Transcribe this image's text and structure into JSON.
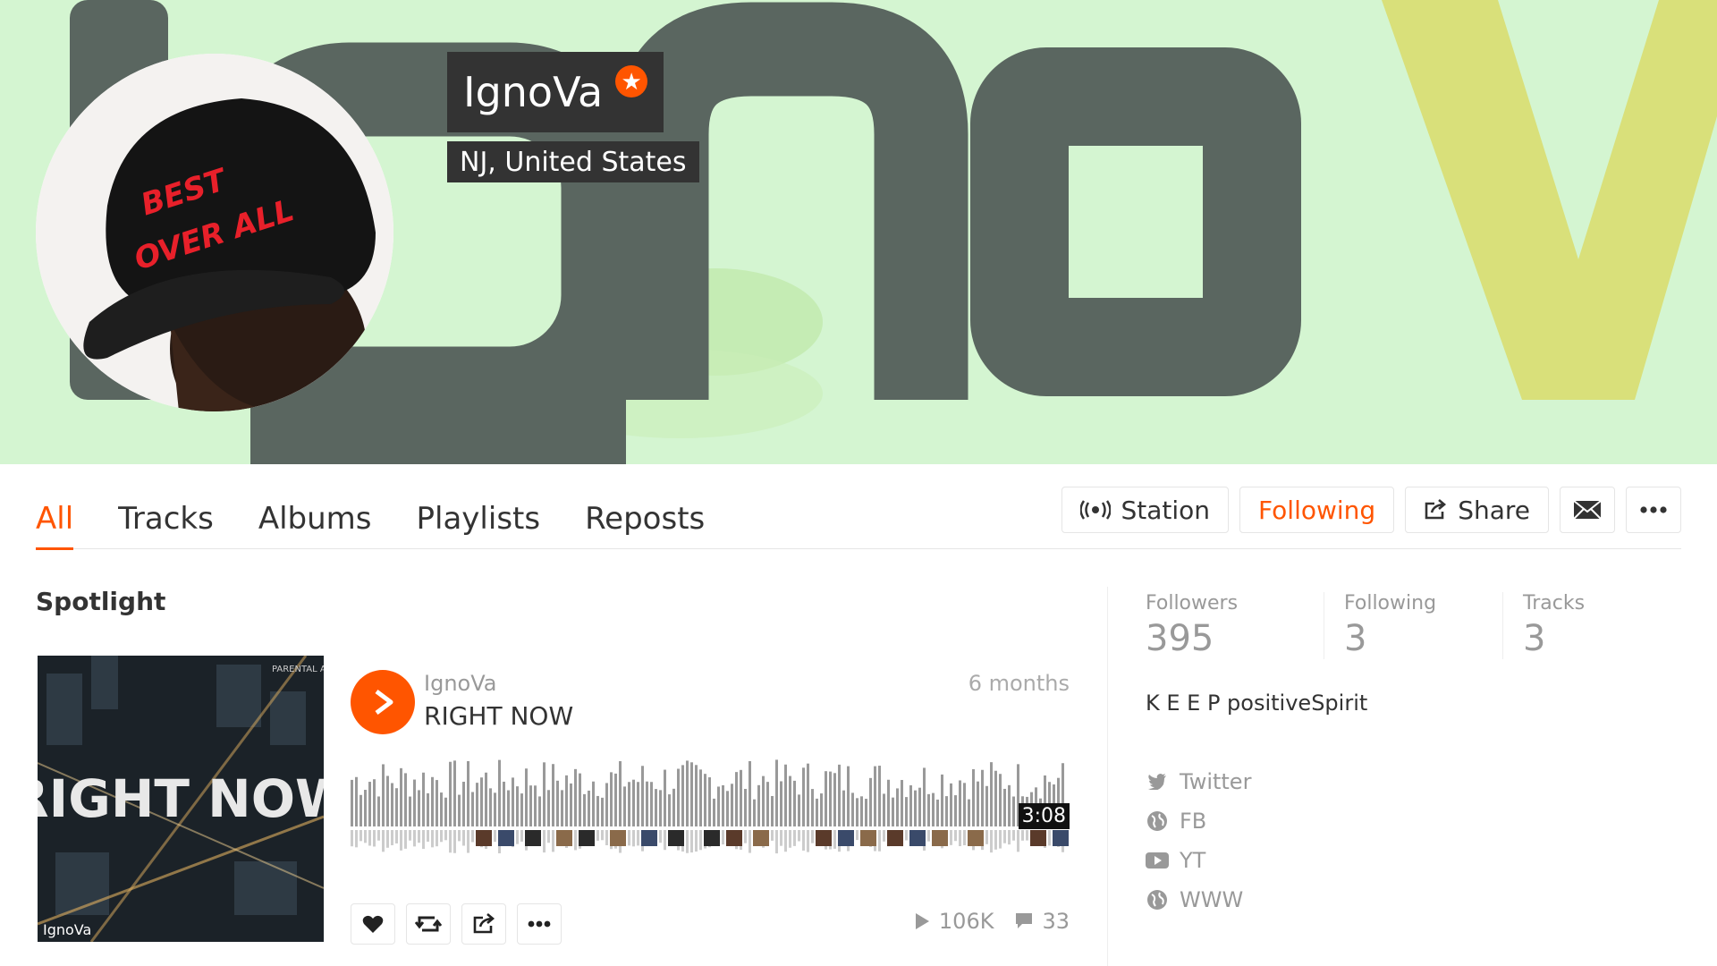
{
  "profile": {
    "name": "IgnoVa",
    "location": "NJ, United States",
    "pro_badge_icon": "star-icon",
    "banner_text": "IgnoVa",
    "avatar_cap_text": "BEST OVER ALL"
  },
  "tabs": [
    {
      "label": "All",
      "active": true
    },
    {
      "label": "Tracks"
    },
    {
      "label": "Albums"
    },
    {
      "label": "Playlists"
    },
    {
      "label": "Reposts"
    }
  ],
  "actions": {
    "station_label": "Station",
    "following_label": "Following",
    "share_label": "Share"
  },
  "spotlight": {
    "title": "Spotlight",
    "track": {
      "user": "IgnoVa",
      "title": "RIGHT NOW",
      "posted": "6 months",
      "duration": "3:08",
      "plays": "106K",
      "comments": "33",
      "cover_text": "RIGHT NOW",
      "cover_brand": "IgnoVa",
      "cover_advisory": "PARENTAL ADVISORY"
    }
  },
  "sidebar": {
    "stats": [
      {
        "label": "Followers",
        "value": "395"
      },
      {
        "label": "Following",
        "value": "3"
      },
      {
        "label": "Tracks",
        "value": "3"
      }
    ],
    "bio": "K E E P positiveSpirit",
    "links": [
      {
        "label": "Twitter",
        "icon": "twitter-icon"
      },
      {
        "label": "FB",
        "icon": "globe-icon"
      },
      {
        "label": "YT",
        "icon": "youtube-icon"
      },
      {
        "label": "WWW",
        "icon": "globe-icon"
      }
    ]
  },
  "colors": {
    "accent": "#ff5500",
    "banner_bg": "#d4f5d1",
    "banner_letters": "#5a6660",
    "banner_v": "#d9e07a"
  }
}
